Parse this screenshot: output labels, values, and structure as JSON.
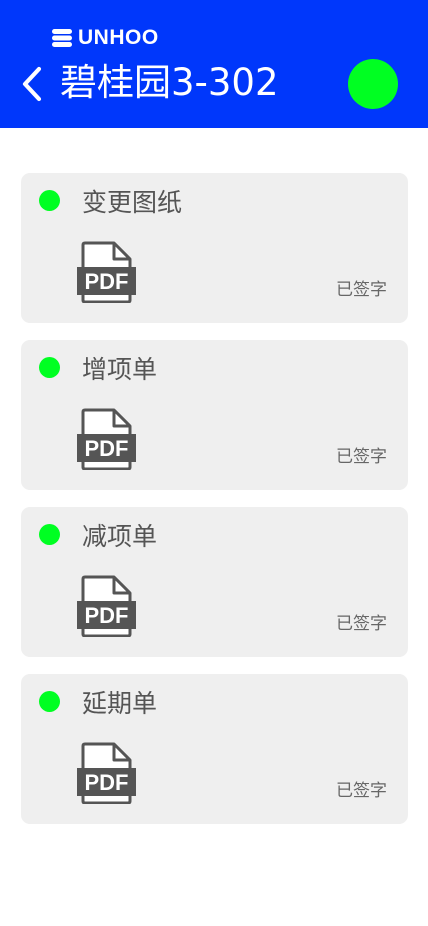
{
  "brand": {
    "logo_text": "UNHOO",
    "icon": "brand-logo-icon"
  },
  "header": {
    "back_icon": "chevron-left-icon",
    "title": "碧桂园3-302",
    "status_color": "#00ff22",
    "background_color": "#0037fb"
  },
  "documents": [
    {
      "title": "变更图纸",
      "file_type": "PDF",
      "status": "已签字",
      "status_color": "#00ff22"
    },
    {
      "title": "增项单",
      "file_type": "PDF",
      "status": "已签字",
      "status_color": "#00ff22"
    },
    {
      "title": "减项单",
      "file_type": "PDF",
      "status": "已签字",
      "status_color": "#00ff22"
    },
    {
      "title": "延期单",
      "file_type": "PDF",
      "status": "已签字",
      "status_color": "#00ff22"
    }
  ]
}
